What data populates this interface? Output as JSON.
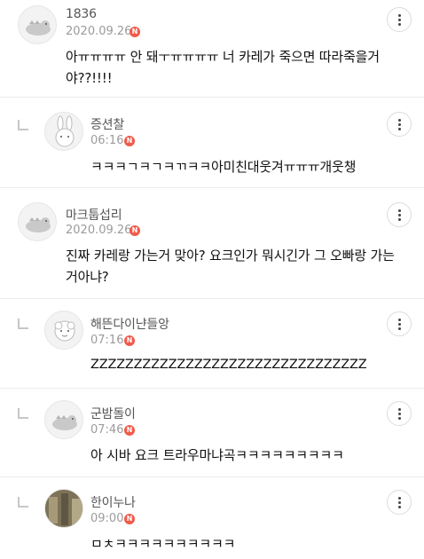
{
  "comments": [
    {
      "author": "1836",
      "date": "2020.09.26",
      "badge": "N",
      "body": "아ㅠㅠㅠㅠ 안 돼ㅜㅠㅠㅠㅠ 너 카레가 죽으면 따라죽을거야??!!!!",
      "avatar_icon": "dinosaur-avatar-icon"
    },
    {
      "author": "증션찰",
      "date": "06:16",
      "badge": "N",
      "body": "ㅋㅋㅋㄱㅋㄱㅋㄲㅋㅋ아미친대웃겨ㅠㅠㅠ개웃챙",
      "avatar_icon": "rabbit-avatar-icon"
    },
    {
      "author": "마크툽섭리",
      "date": "2020.09.26",
      "badge": "N",
      "body": "진짜 카레랑 가는거 맞아? 요크인가 뭐시긴가 그 오빠랑 가는 거아냐?",
      "avatar_icon": "dinosaur-avatar-icon"
    },
    {
      "author": "해뜬다이냔들앙",
      "date": "07:16",
      "badge": "N",
      "body": "ZZZZZZZZZZZZZZZZZZZZZZZZZZZZZZZZ",
      "avatar_icon": "sheep-avatar-icon"
    },
    {
      "author": "군밤돌이",
      "date": "07:46",
      "badge": "N",
      "body": "아 시바 요크 트라우마냐곡ㅋㅋㅋㅋㅋㅋㅋㅋㅋ",
      "avatar_icon": "dinosaur-avatar-icon"
    },
    {
      "author": "한이누나",
      "date": "09:00",
      "badge": "N",
      "body": "ㅁㅊㅋㅋㅋㅋㅋㅋㅋㅋㅋㅋ",
      "avatar_icon": "photo-avatar-icon"
    }
  ]
}
